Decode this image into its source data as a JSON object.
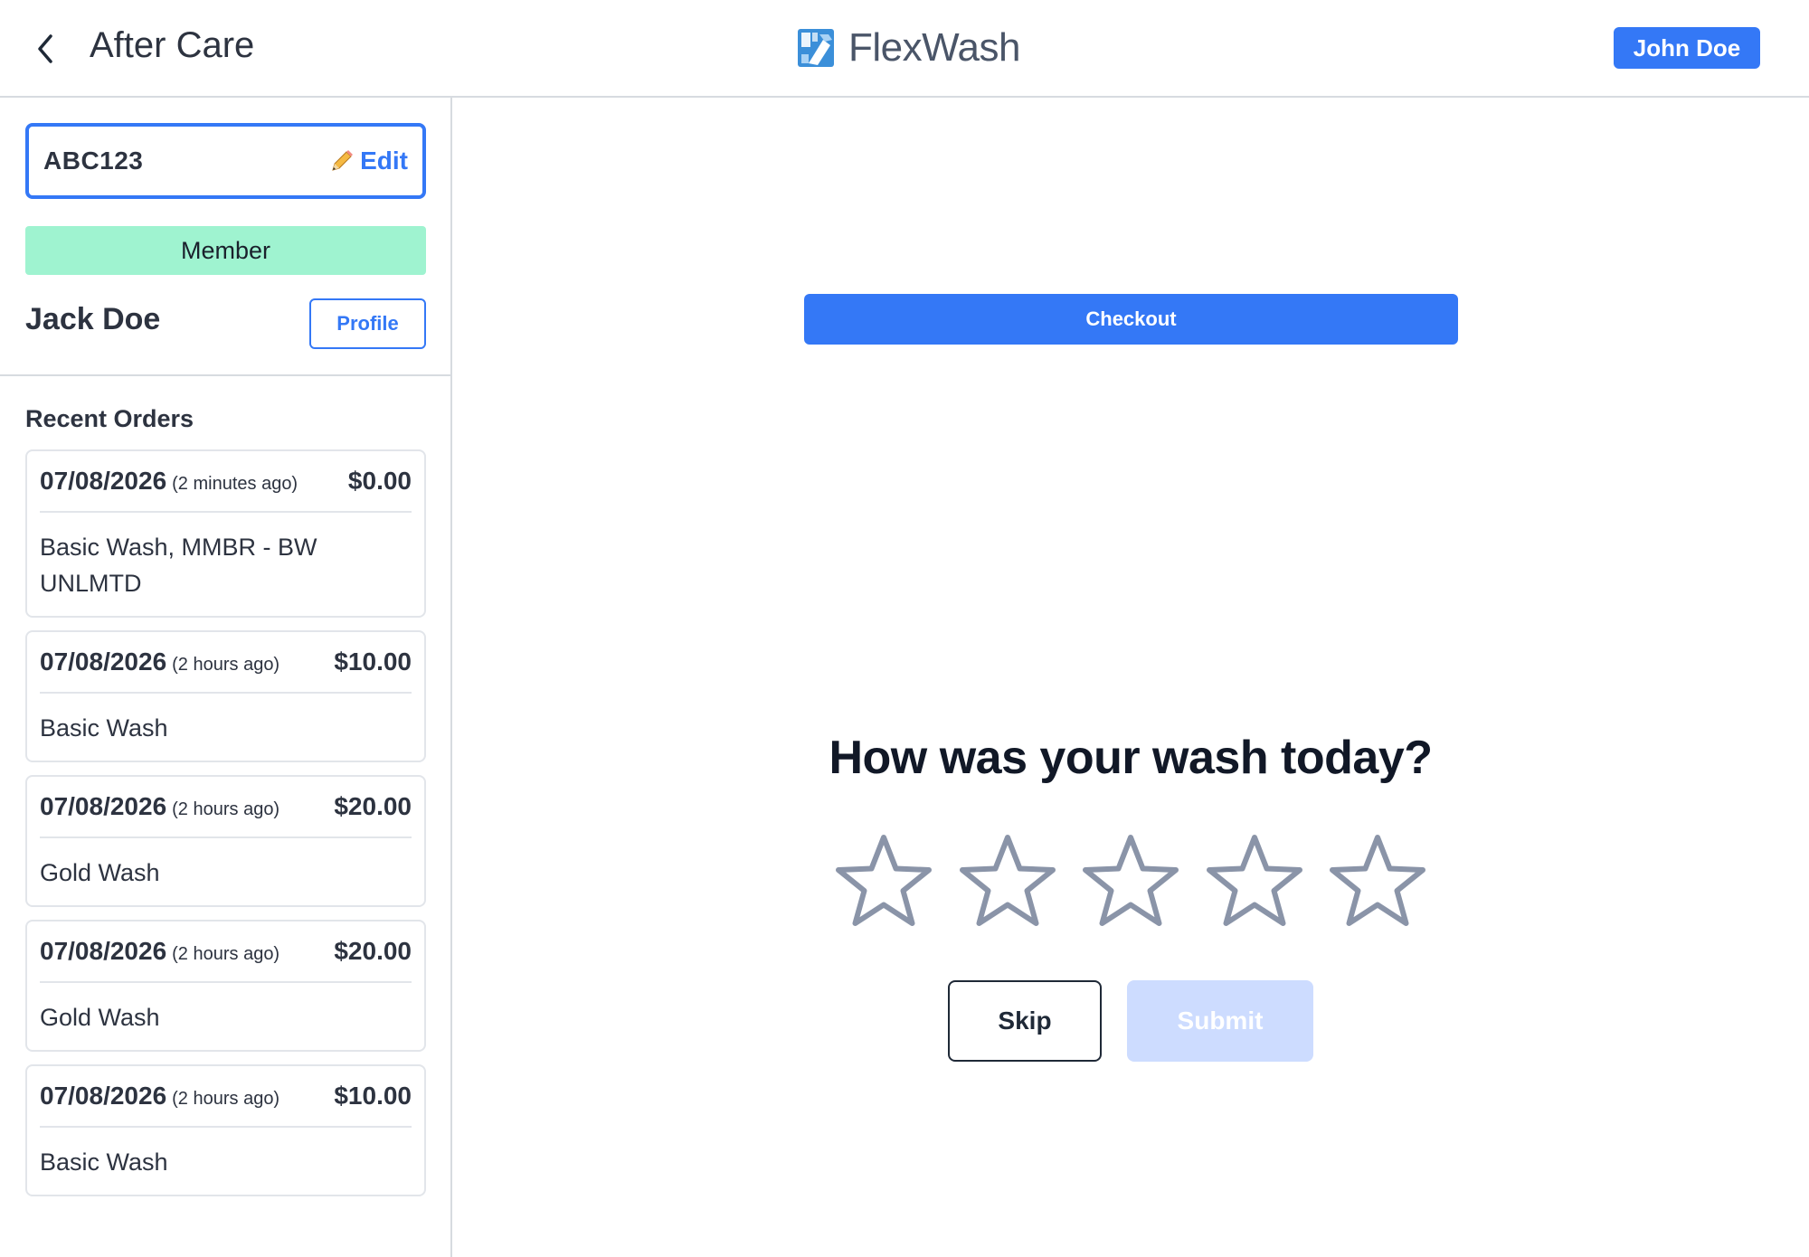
{
  "header": {
    "back_icon": "chevron-left-icon",
    "title": "After Care",
    "brand_name": "FlexWash",
    "user_name": "John Doe"
  },
  "sidebar": {
    "plate": "ABC123",
    "edit_label": "Edit",
    "member_label": "Member",
    "customer_name": "Jack Doe",
    "profile_label": "Profile",
    "recent_orders_title": "Recent Orders",
    "orders": [
      {
        "date": "07/08/2026",
        "ago": "(2 minutes ago)",
        "price": "$0.00",
        "items": "Basic Wash, MMBR - BW UNLMTD"
      },
      {
        "date": "07/08/2026",
        "ago": "(2 hours ago)",
        "price": "$10.00",
        "items": "Basic Wash"
      },
      {
        "date": "07/08/2026",
        "ago": "(2 hours ago)",
        "price": "$20.00",
        "items": "Gold Wash"
      },
      {
        "date": "07/08/2026",
        "ago": "(2 hours ago)",
        "price": "$20.00",
        "items": "Gold Wash"
      },
      {
        "date": "07/08/2026",
        "ago": "(2 hours ago)",
        "price": "$10.00",
        "items": "Basic Wash"
      }
    ]
  },
  "main": {
    "checkout_label": "Checkout",
    "question": "How was your wash today?",
    "rating": 0,
    "rating_max": 5,
    "skip_label": "Skip",
    "submit_label": "Submit"
  },
  "colors": {
    "accent": "#3478f6",
    "member_badge": "#9ff3d0",
    "submit_disabled": "#cddcff",
    "star_outline": "#8a94a8"
  }
}
